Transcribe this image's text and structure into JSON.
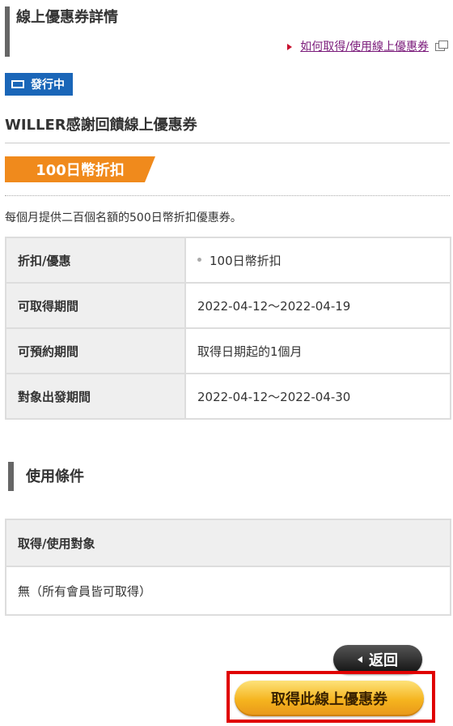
{
  "header": {
    "title": "線上優惠券詳情",
    "howto_link": "如何取得/使用線上優惠券"
  },
  "status": {
    "label": "發行中",
    "color": "#1a66b8"
  },
  "coupon": {
    "name": "WILLER感謝回饋線上優惠券",
    "discount_tag": "100日幣折扣",
    "description": "每個月提供二百個名額的500日幣折扣優惠券。"
  },
  "details": [
    {
      "key": "折扣/優惠",
      "value": "100日幣折扣",
      "bullet": true
    },
    {
      "key": "可取得期間",
      "value": "2022-04-12～2022-04-19",
      "bullet": false
    },
    {
      "key": "可預約期間",
      "value": "取得日期起的1個月",
      "bullet": false
    },
    {
      "key": "對象出發期間",
      "value": "2022-04-12～2022-04-30",
      "bullet": false
    }
  ],
  "conditions": {
    "section_title": "使用條件",
    "head": "取得/使用對象",
    "body": "無（所有會員皆可取得）"
  },
  "buttons": {
    "back": "返回",
    "get": "取得此線上優惠券"
  },
  "colors": {
    "accent_orange": "#f08a1c",
    "highlight_red": "#e00000"
  },
  "icons": {
    "status": "badge-outline-icon",
    "howto_arrow": "triangle-right-icon",
    "external": "external-window-icon",
    "back_arrow": "triangle-left-icon"
  }
}
